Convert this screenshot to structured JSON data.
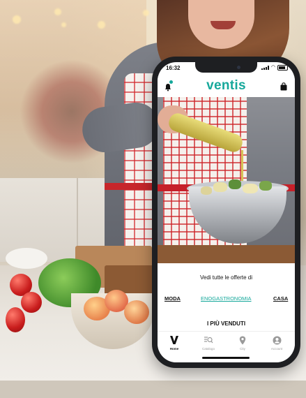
{
  "status_bar": {
    "time": "16:32"
  },
  "app": {
    "logo_text": "ventis",
    "accent_color": "#16a89b",
    "left_icon": "bell-icon",
    "right_icon": "shopping-bag-icon"
  },
  "offers": {
    "title": "Vedi tutte le offerte di",
    "categories": [
      {
        "label": "MODA",
        "active": false
      },
      {
        "label": "ENOGASTRONOMIA",
        "active": true
      },
      {
        "label": "CASA",
        "active": false
      }
    ]
  },
  "best_sellers": {
    "title": "I PIÙ VENDUTI"
  },
  "tab_bar": {
    "items": [
      {
        "label": "Home",
        "icon": "v-logo-icon",
        "active": true
      },
      {
        "label": "Catalogo",
        "icon": "catalog-search-icon",
        "active": false
      },
      {
        "label": "City",
        "icon": "location-pin-icon",
        "active": false
      },
      {
        "label": "Account",
        "icon": "account-icon",
        "active": false
      }
    ]
  }
}
